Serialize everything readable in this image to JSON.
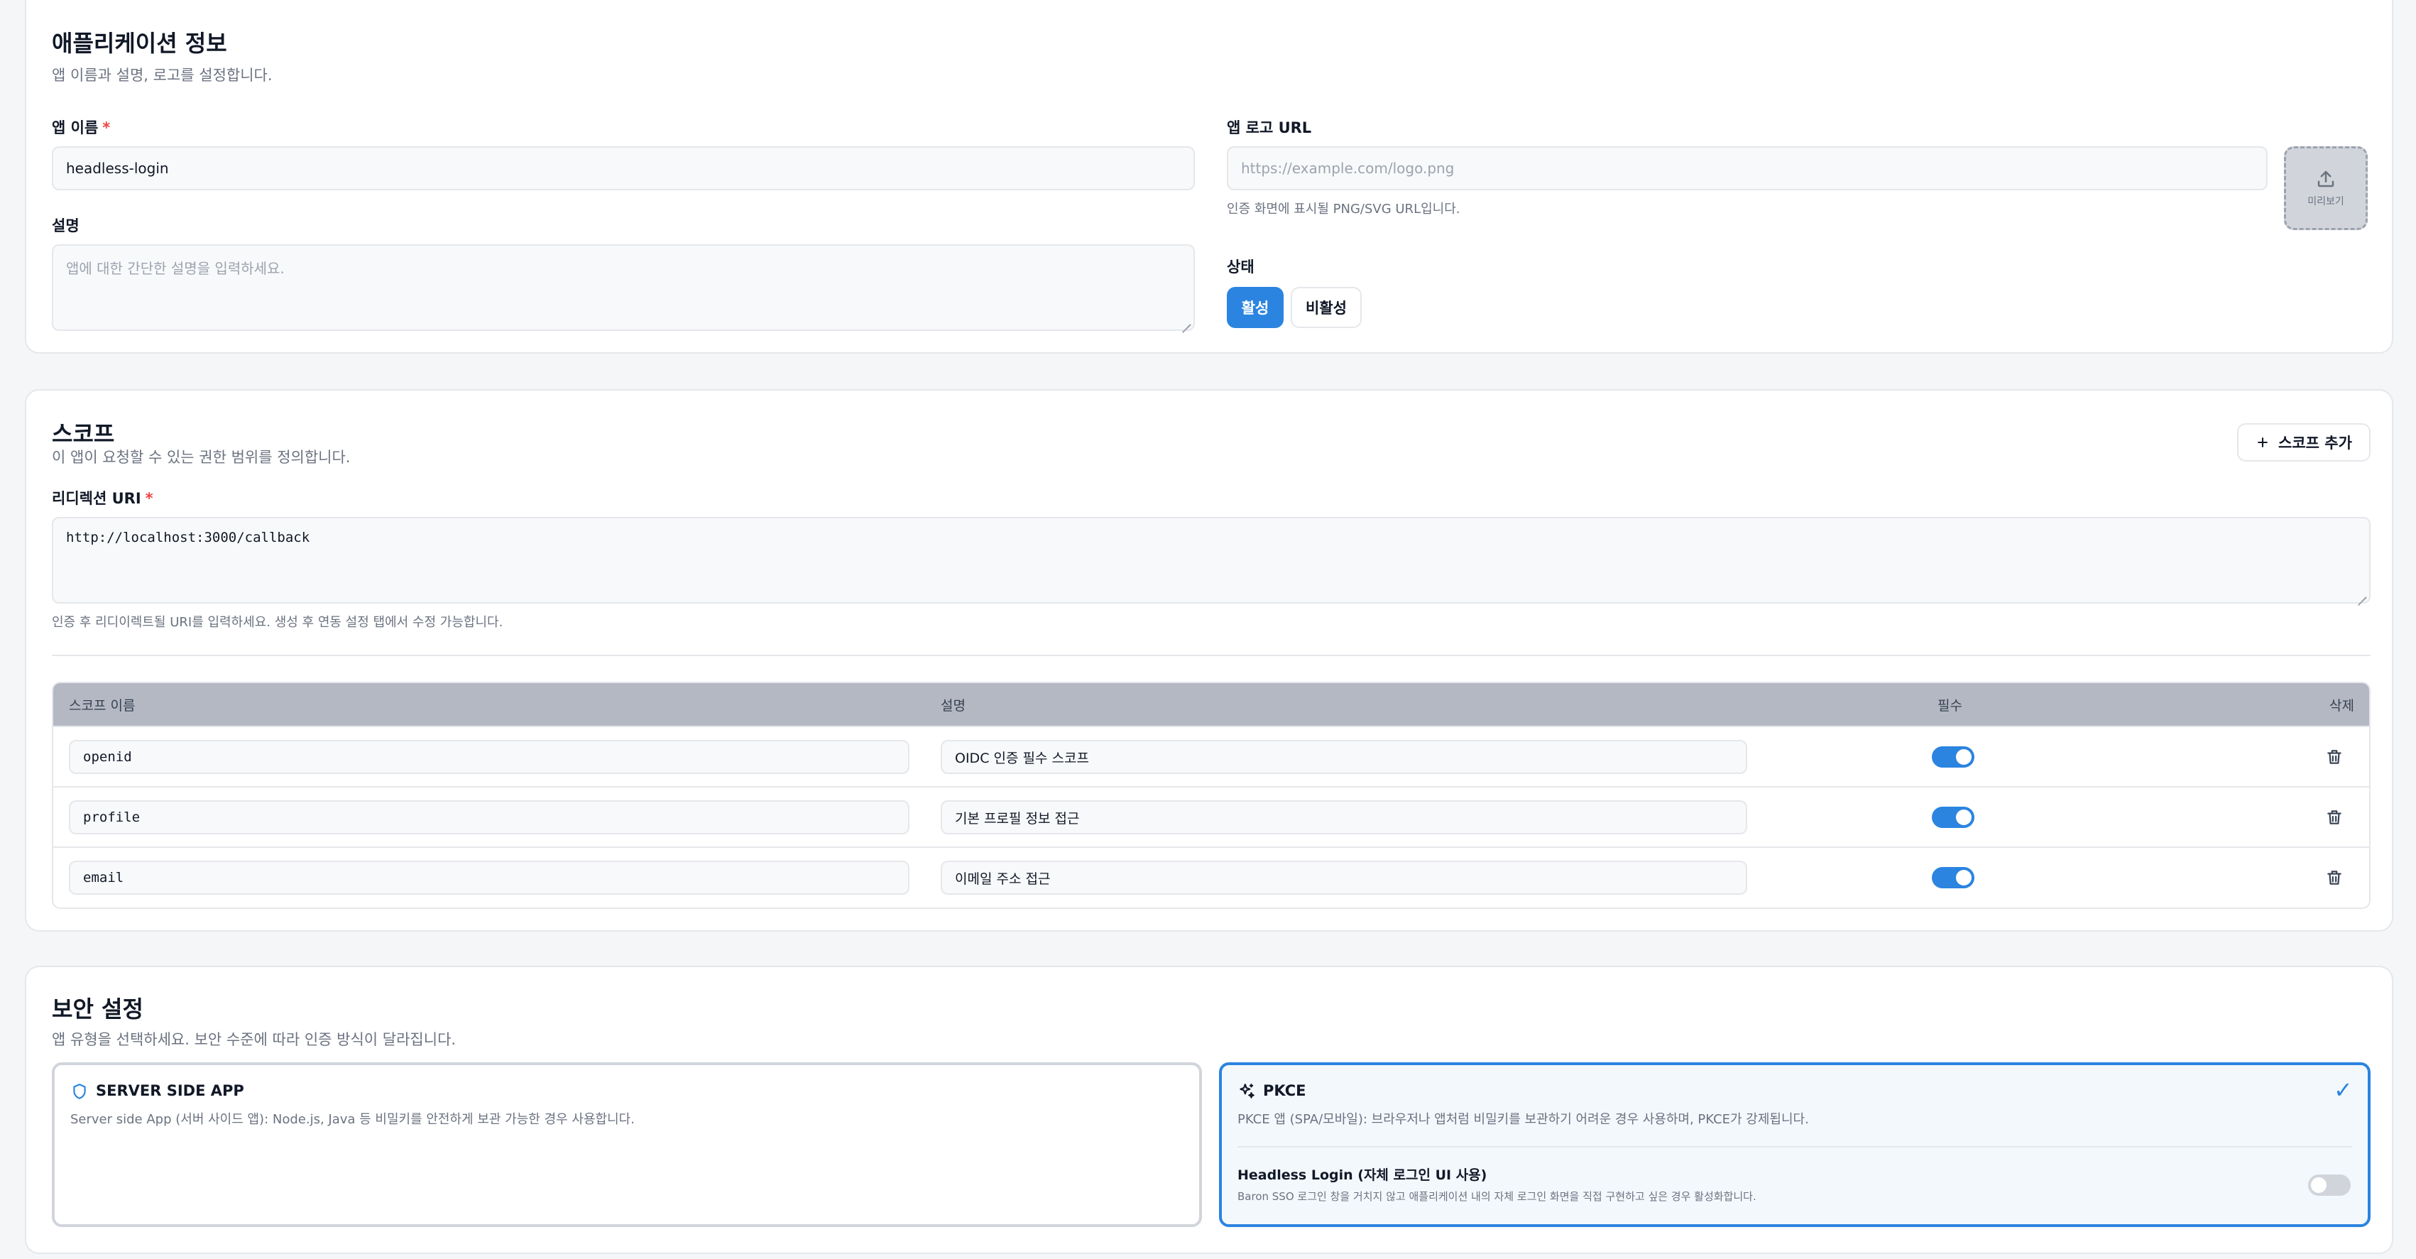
{
  "app_info": {
    "title": "애플리케이션 정보",
    "description": "앱 이름과 설명, 로고를 설정합니다.",
    "name_label": "앱 이름",
    "required_mark": "*",
    "name_value": "headless-login",
    "desc_label": "설명",
    "desc_placeholder": "앱에 대한 간단한 설명을 입력하세요.",
    "logo_label": "앱 로고 URL",
    "logo_placeholder": "https://example.com/logo.png",
    "logo_hint": "인증 화면에 표시될 PNG/SVG URL입니다.",
    "preview_label": "미리보기",
    "status_label": "상태",
    "status_options": [
      "활성",
      "비활성"
    ],
    "status_selected": "활성"
  },
  "scope": {
    "title": "스코프",
    "description": "이 앱이 요청할 수 있는 권한 범위를 정의합니다.",
    "add_button": "스코프 추가",
    "redirect_label": "리디렉션 URI",
    "required_mark": "*",
    "redirect_value": "http://localhost:3000/callback",
    "redirect_hint": "인증 후 리디이렉트될 URI를 입력하세요. 생성 후 연동 설정 탭에서 수정 가능합니다.",
    "columns": [
      "스코프 이름",
      "설명",
      "필수",
      "삭제"
    ],
    "rows": [
      {
        "name": "openid",
        "desc": "OIDC 인증 필수 스코프",
        "required": true
      },
      {
        "name": "profile",
        "desc": "기본 프로필 정보 접근",
        "required": true
      },
      {
        "name": "email",
        "desc": "이메일 주소 접근",
        "required": true
      }
    ]
  },
  "security": {
    "title": "보안 설정",
    "description": "앱 유형을 선택하세요. 보안 수준에 따라 인증 방식이 달라집니다.",
    "options": [
      {
        "title": "SERVER SIDE APP",
        "desc": "Server side App (서버 사이드 앱): Node.js, Java 등 비밀키를 안전하게 보관 가능한 경우 사용합니다.",
        "selected": false
      },
      {
        "title": "PKCE",
        "desc": "PKCE 앱 (SPA/모바일): 브라우저나 앱처럼 비밀키를 보관하기 어려운 경우 사용하며, PKCE가 강제됩니다.",
        "selected": true
      }
    ],
    "check_mark": "✓",
    "headless_title": "Headless Login (자체 로그인 UI 사용)",
    "headless_desc": "Baron SSO 로그인 창을 거치지 않고 애플리케이션 내의 자체 로그인 화면을 직접 구현하고 싶은 경우 활성화합니다.",
    "headless_enabled": false
  },
  "colors": {
    "accent": "#2b84e0",
    "required": "#ef4444",
    "table_header": "#b3b8c3"
  }
}
